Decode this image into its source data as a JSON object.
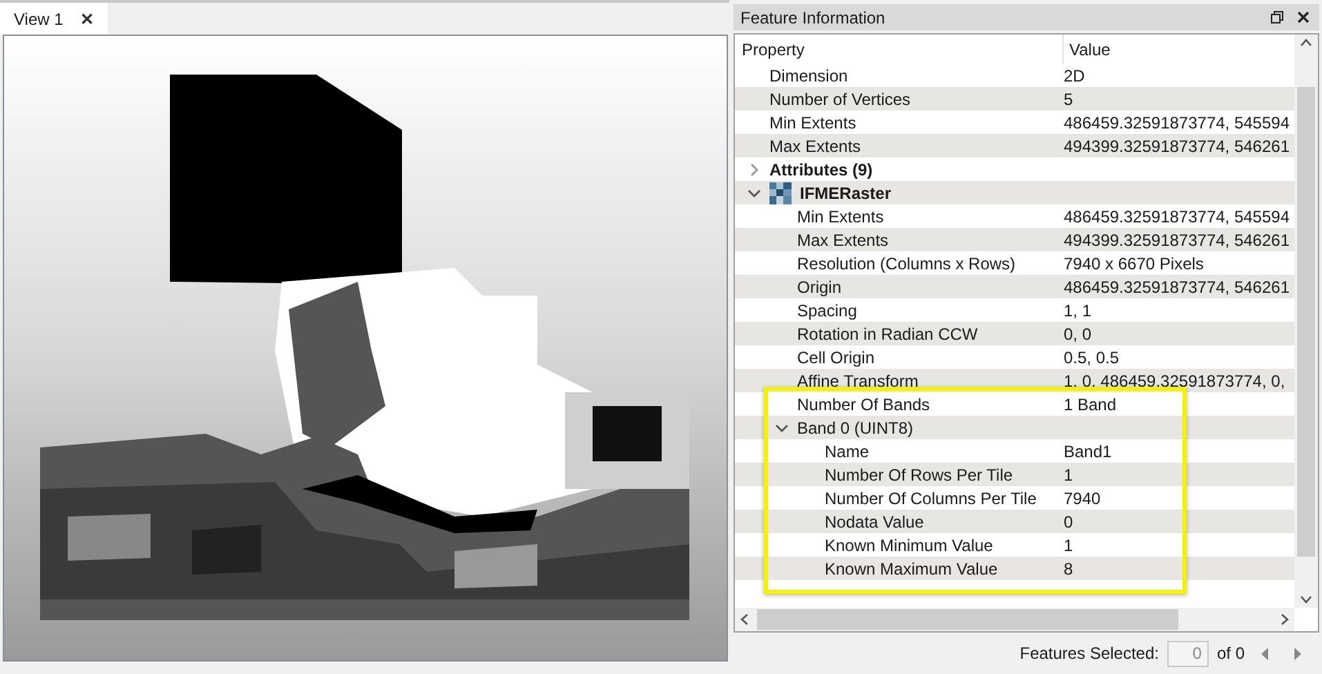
{
  "view_tab": {
    "label": "View 1",
    "close": "✕",
    "selected": true
  },
  "panel": {
    "title": "Feature Information"
  },
  "tree": {
    "columns": [
      "Property",
      "Value"
    ],
    "rows": [
      {
        "kind": "property",
        "label": "Dimension",
        "value": "2D"
      },
      {
        "kind": "property",
        "label": "Number of Vertices",
        "value": "5"
      },
      {
        "kind": "property",
        "label": "Min Extents",
        "value": "486459.32591873774, 545594"
      },
      {
        "kind": "property",
        "label": "Max Extents",
        "value": "494399.32591873774, 546261"
      },
      {
        "kind": "group",
        "label": "Attributes (9)",
        "expanded": false,
        "children": []
      },
      {
        "kind": "raster",
        "label": "IFMERaster",
        "expanded": true,
        "children": [
          {
            "kind": "property",
            "label": "Min Extents",
            "value": "486459.32591873774, 545594",
            "highlighted": false
          },
          {
            "kind": "property",
            "label": "Max Extents",
            "value": "494399.32591873774, 546261",
            "highlighted": false
          },
          {
            "kind": "property",
            "label": "Resolution (Columns x Rows)",
            "value": "7940 x 6670 Pixels",
            "highlighted": false
          },
          {
            "kind": "property",
            "label": "Origin",
            "value": "486459.32591873774, 546261",
            "highlighted": false
          },
          {
            "kind": "property",
            "label": "Spacing",
            "value": "1, 1",
            "highlighted": false
          },
          {
            "kind": "property",
            "label": "Rotation in Radian CCW",
            "value": "0, 0",
            "highlighted": false
          },
          {
            "kind": "property",
            "label": "Cell Origin",
            "value": "0.5, 0.5",
            "highlighted": false
          },
          {
            "kind": "property",
            "label": "Affine Transform",
            "value": "1, 0, 486459.32591873774, 0,",
            "highlighted": false
          },
          {
            "kind": "property",
            "label": "Number Of Bands",
            "value": "1 Band",
            "highlighted": true
          },
          {
            "kind": "group",
            "label": "Band 0 (UINT8)",
            "expanded": true,
            "highlighted": true,
            "children": [
              {
                "kind": "property",
                "label": "Name",
                "value": "Band1"
              },
              {
                "kind": "property",
                "label": "Number Of Rows Per Tile",
                "value": "1"
              },
              {
                "kind": "property",
                "label": "Number Of Columns Per Tile",
                "value": "7940"
              },
              {
                "kind": "property",
                "label": "Nodata Value",
                "value": "0"
              },
              {
                "kind": "property",
                "label": "Known Minimum Value",
                "value": "1"
              },
              {
                "kind": "property",
                "label": "Known Maximum Value",
                "value": "8"
              }
            ]
          }
        ]
      }
    ]
  },
  "status": {
    "label": "Features Selected:",
    "field_value": "0",
    "total": "of 0"
  }
}
